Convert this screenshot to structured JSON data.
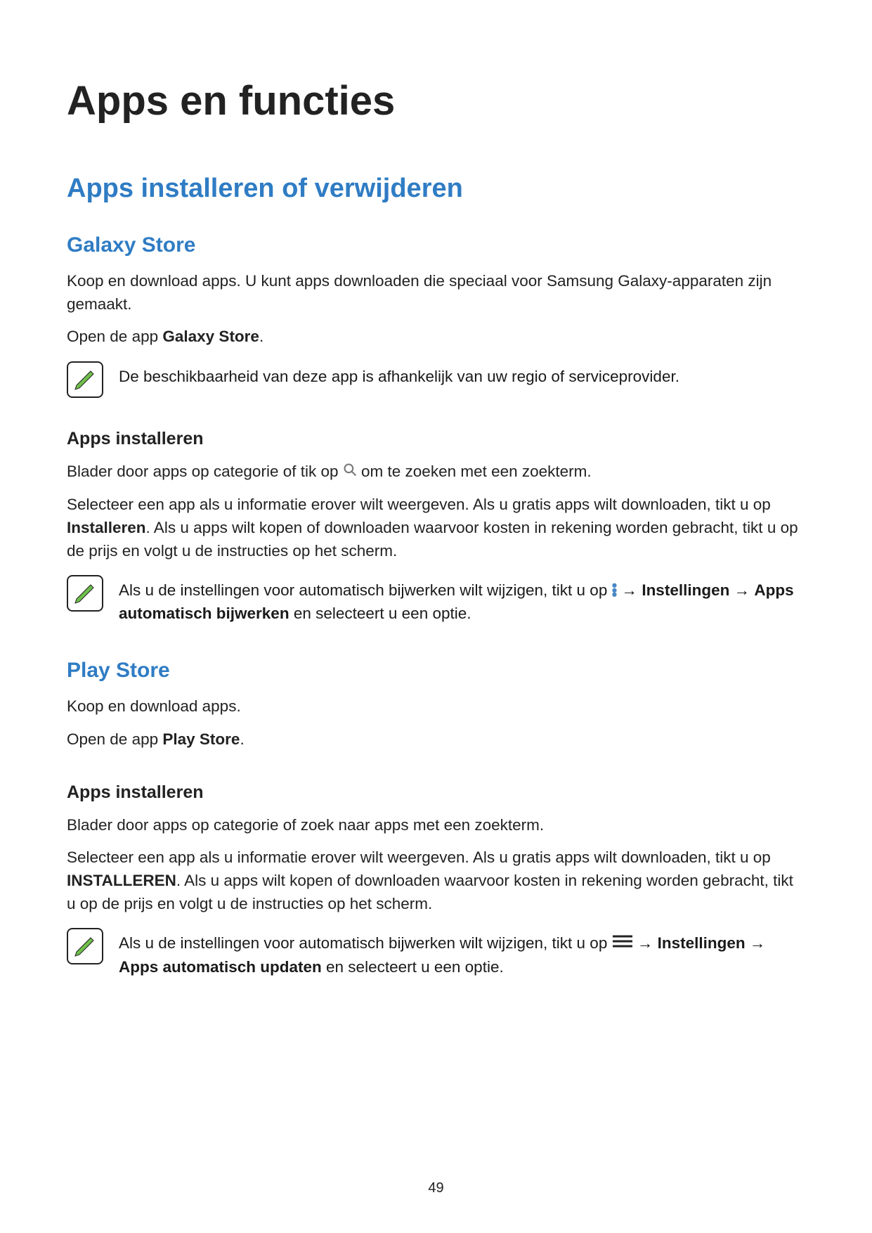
{
  "page_number": "49",
  "h1": "Apps en functies",
  "h2": "Apps installeren of verwijderen",
  "galaxy": {
    "heading": "Galaxy Store",
    "p1": "Koop en download apps. U kunt apps downloaden die speciaal voor Samsung Galaxy-apparaten zijn gemaakt.",
    "p2_pre": "Open de app ",
    "p2_bold": "Galaxy Store",
    "p2_post": ".",
    "note1": "De beschikbaarheid van deze app is afhankelijk van uw regio of serviceprovider.",
    "install_h": "Apps installeren",
    "install_p1_pre": "Blader door apps op categorie of tik op ",
    "install_p1_post": " om te zoeken met een zoekterm.",
    "install_p2_a": "Selecteer een app als u informatie erover wilt weergeven. Als u gratis apps wilt downloaden, tikt u op ",
    "install_p2_b": "Installeren",
    "install_p2_c": ". Als u apps wilt kopen of downloaden waarvoor kosten in rekening worden gebracht, tikt u op de prijs en volgt u de instructies op het scherm.",
    "note2_a": "Als u de instellingen voor automatisch bijwerken wilt wijzigen, tikt u op ",
    "note2_arrow1": " → ",
    "note2_b": "Instellingen",
    "note2_arrow2": " → ",
    "note2_c": "Apps automatisch bijwerken",
    "note2_d": " en selecteert u een optie."
  },
  "play": {
    "heading": "Play Store",
    "p1": "Koop en download apps.",
    "p2_pre": "Open de app ",
    "p2_bold": "Play Store",
    "p2_post": ".",
    "install_h": "Apps installeren",
    "install_p1": "Blader door apps op categorie of zoek naar apps met een zoekterm.",
    "install_p2_a": "Selecteer een app als u informatie erover wilt weergeven. Als u gratis apps wilt downloaden, tikt u op ",
    "install_p2_b": "INSTALLEREN",
    "install_p2_c": ". Als u apps wilt kopen of downloaden waarvoor kosten in rekening worden gebracht, tikt u op de prijs en volgt u de instructies op het scherm.",
    "note_a": "Als u de instellingen voor automatisch bijwerken wilt wijzigen, tikt u op ",
    "note_arrow1": " → ",
    "note_b": "Instellingen",
    "note_arrow2": " → ",
    "note_c": "Apps automatisch updaten",
    "note_d": " en selecteert u een optie."
  }
}
